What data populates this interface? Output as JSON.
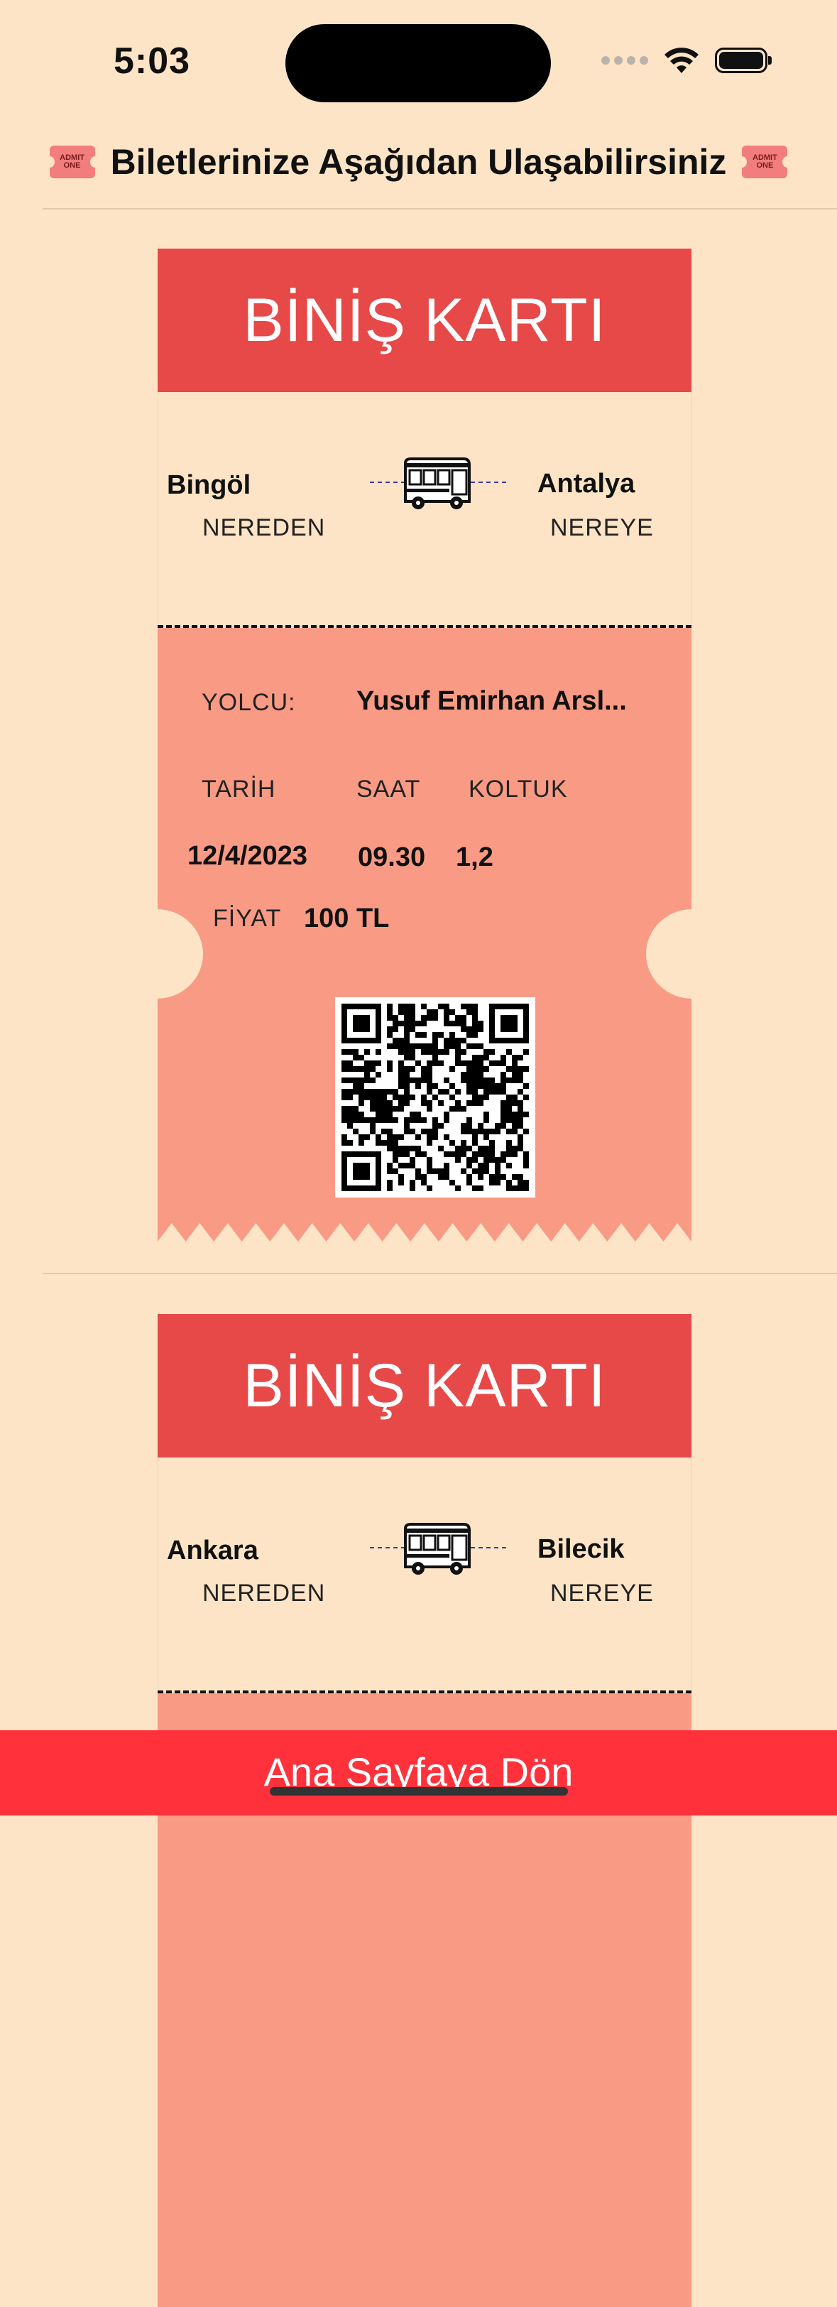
{
  "status_bar": {
    "time": "5:03"
  },
  "header": {
    "title": "Biletlerinize Aşağıdan Ulaşabilirsiniz",
    "icon_text_line1": "ADMIT",
    "icon_text_line2": "ONE"
  },
  "tickets": [
    {
      "title": "BİNİŞ KARTI",
      "from_city": "Bingöl",
      "from_caption": "NEREDEN",
      "to_city": "Antalya",
      "to_caption": "NEREYE",
      "passenger_label": "YOLCU:",
      "passenger_name": "Yusuf Emirhan Arsl...",
      "date_label": "TARİH",
      "time_label": "SAAT",
      "seat_label": "KOLTUK",
      "date": "12/4/2023",
      "time": "09.30",
      "seat": "1,2",
      "price_label": "FİYAT",
      "price": "100 TL"
    },
    {
      "title": "BİNİŞ KARTI",
      "from_city": "Ankara",
      "from_caption": "NEREDEN",
      "to_city": "Bilecik",
      "to_caption": "NEREYE"
    }
  ],
  "bottom_button": {
    "label": "Ana Sayfaya Dön"
  },
  "colors": {
    "background": "#FDE4C6",
    "ticket_header": "#E74848",
    "ticket_body": "#F99A85",
    "bottom_button": "#FF323C"
  }
}
